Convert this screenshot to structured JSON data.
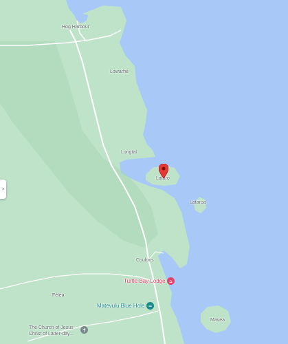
{
  "map": {
    "colors": {
      "water": "#a8c8f8",
      "land": "#bfe3c9",
      "land_dark": "#a7d6b4",
      "road": "#ffffff",
      "marker": "#e53935",
      "poi_red": "#e0446a",
      "poi_teal": "#188a8a",
      "poi_gray": "#7a8a8a"
    },
    "places": {
      "hog_harbour": "Hog Harbour",
      "lowarhe": "Lowarhé",
      "longtal": "Longtal",
      "lataro": "Lataro",
      "lataroa": "Lataroa",
      "coulons": "Coulons",
      "feleа": "Féléa",
      "mavea": "Mavea"
    },
    "pois": {
      "turtle_bay": {
        "name": "Turtle Bay Lodge",
        "icon": "lodging-icon"
      },
      "matevulu": {
        "name": "Matevulu Blue Hole",
        "icon": "swimming-icon"
      },
      "church": {
        "name_line1": "The Church of Jesus",
        "name_line2": "Christ of Latter-day...",
        "icon": "church-icon"
      }
    },
    "side_handle": {
      "icon": "chevron-right-icon",
      "glyph": "›"
    }
  }
}
